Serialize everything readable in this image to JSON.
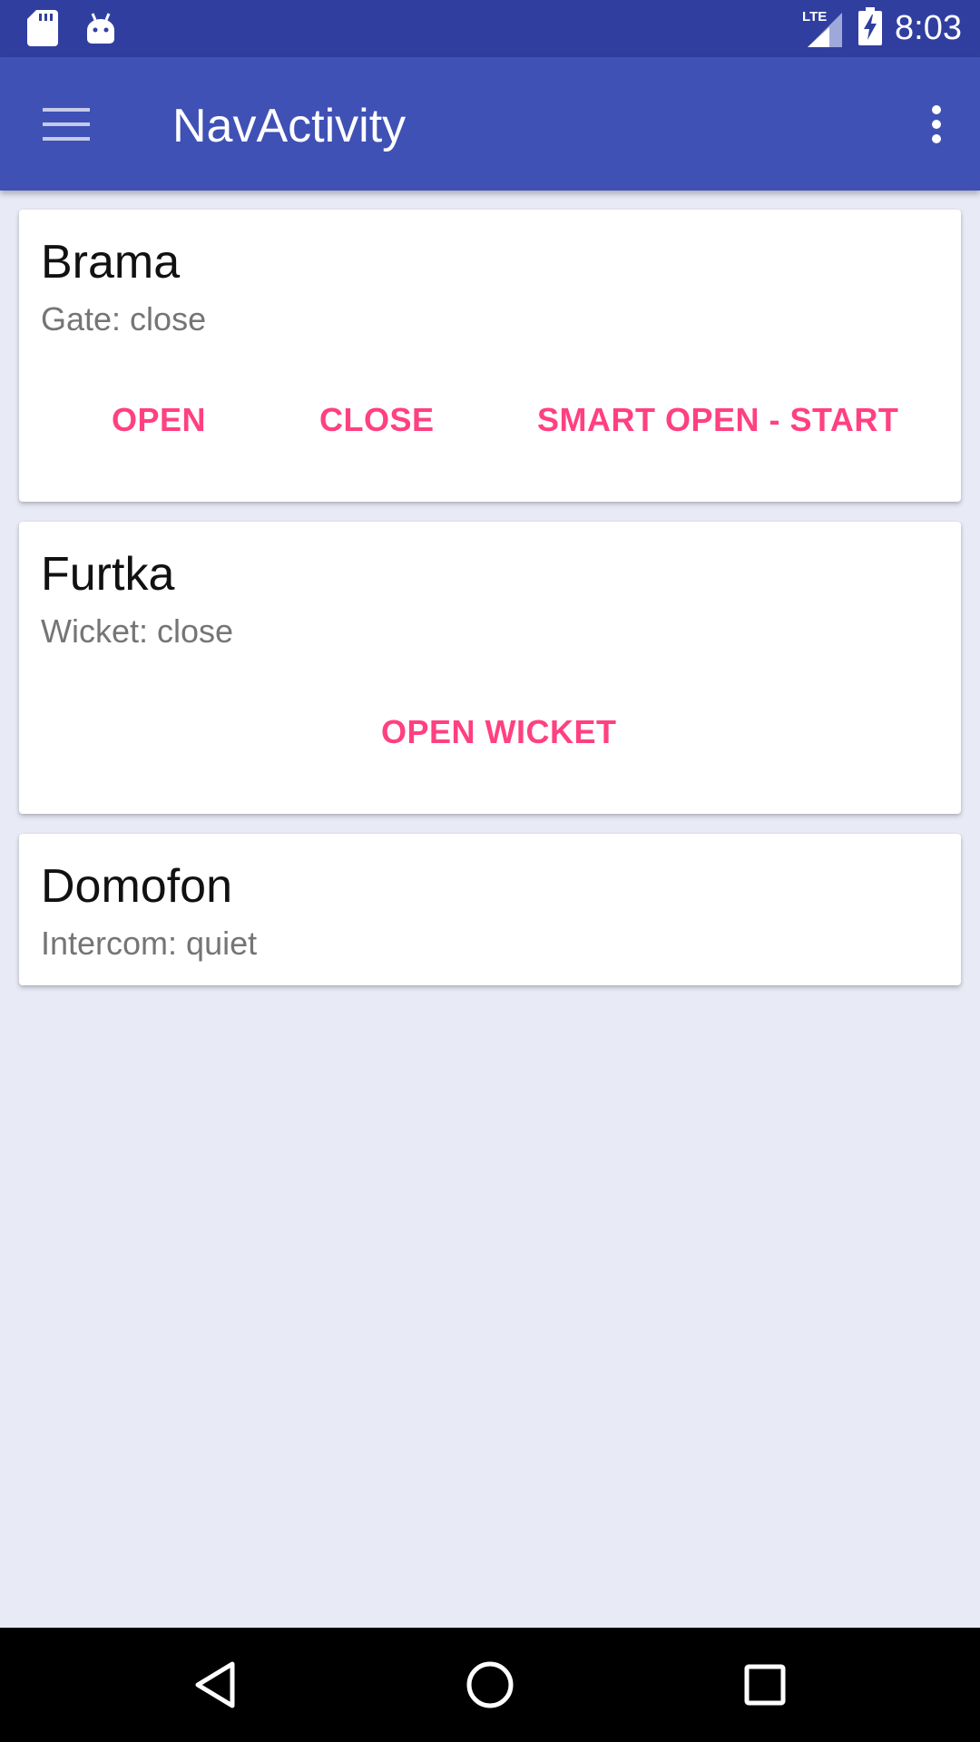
{
  "status_bar": {
    "time": "8:03",
    "network": "LTE",
    "left_icons": [
      "sd-card-icon",
      "android-icon"
    ],
    "right_icons": [
      "signal-icon",
      "battery-charging-icon"
    ]
  },
  "app_bar": {
    "title": "NavActivity",
    "menu_icon": "hamburger-menu-icon",
    "overflow_icon": "more-vertical-icon"
  },
  "cards": [
    {
      "title": "Brama",
      "status": "Gate: close",
      "actions": [
        "OPEN",
        "CLOSE",
        "SMART OPEN - START"
      ]
    },
    {
      "title": "Furtka",
      "status": "Wicket: close",
      "actions": [
        "OPEN WICKET"
      ]
    },
    {
      "title": "Domofon",
      "status": "Intercom: quiet",
      "actions": []
    }
  ],
  "nav_bar": {
    "buttons": [
      "back-icon",
      "home-icon",
      "recents-icon"
    ]
  },
  "colors": {
    "status_bar": "#303f9f",
    "app_bar": "#3f51b5",
    "accent": "#ff4081",
    "background": "#e8eaf6"
  }
}
